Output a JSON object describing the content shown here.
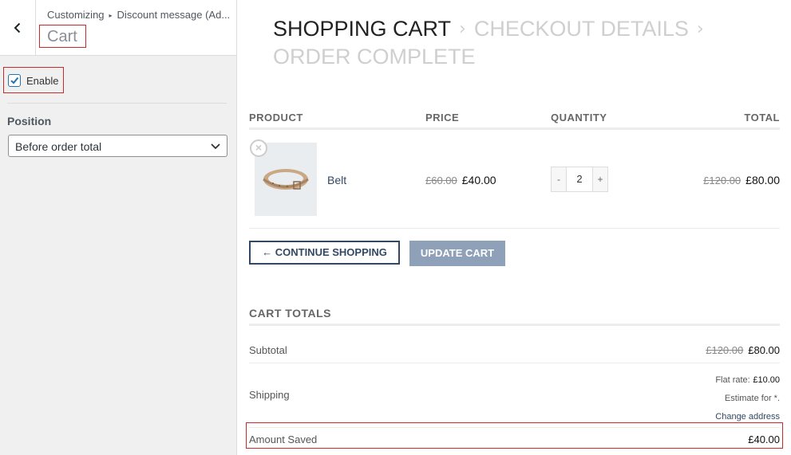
{
  "sidebar": {
    "breadcrumb": {
      "root": "Customizing",
      "child": "Discount message (Ad..."
    },
    "section_title": "Cart",
    "enable_label": "Enable",
    "enable_checked": true,
    "position_label": "Position",
    "position_value": "Before order total"
  },
  "checkout_steps": {
    "step1": "SHOPPING CART",
    "step2": "CHECKOUT DETAILS",
    "step3": "ORDER COMPLETE"
  },
  "cart_table": {
    "headers": [
      "PRODUCT",
      "PRICE",
      "QUANTITY",
      "TOTAL"
    ],
    "rows": [
      {
        "name": "Belt",
        "price_old": "£60.00",
        "price_new": "£40.00",
        "quantity": "2",
        "total_old": "£120.00",
        "total_new": "£80.00"
      }
    ]
  },
  "qty_controls": {
    "minus": "-",
    "plus": "+"
  },
  "buttons": {
    "continue": "← CONTINUE SHOPPING",
    "update": "UPDATE CART"
  },
  "cart_totals": {
    "title": "CART TOTALS",
    "subtotal_label": "Subtotal",
    "subtotal_old": "£120.00",
    "subtotal_new": "£80.00",
    "shipping_label": "Shipping",
    "flat_rate_label": "Flat rate:",
    "flat_rate_value": "£10.00",
    "estimate": "Estimate for *.",
    "change_address": "Change address",
    "amount_saved_label": "Amount Saved",
    "amount_saved_value": "£40.00"
  },
  "colors": {
    "highlight_border": "#c92a2a",
    "link": "#334862",
    "checkbox": "#2271b1"
  }
}
